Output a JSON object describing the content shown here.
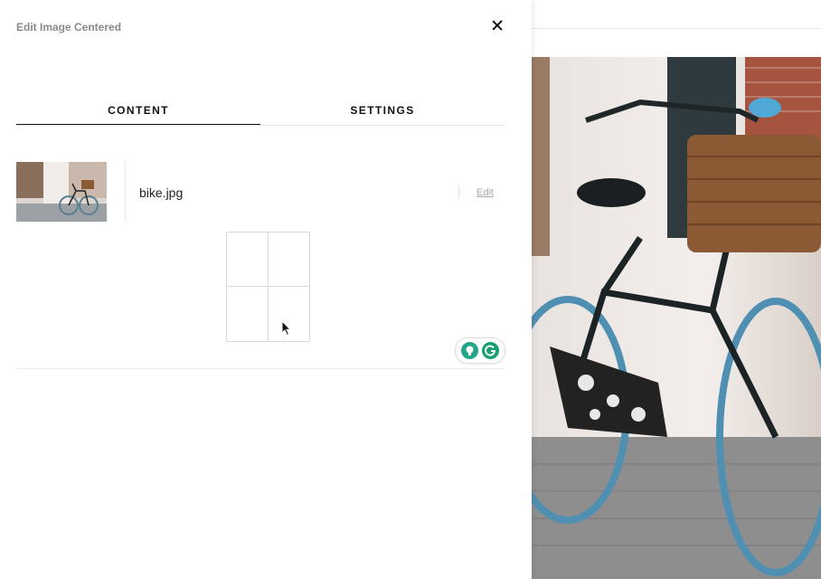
{
  "panel": {
    "title": "Edit Image Centered",
    "tabs": [
      {
        "label": "CONTENT",
        "active": true
      },
      {
        "label": "SETTINGS",
        "active": false
      }
    ]
  },
  "image": {
    "file_name": "bike.jpg",
    "edit_label": "Edit"
  },
  "colors": {
    "accent": "#111111",
    "grammarly_green": "#15a06f",
    "border": "#e6e6e6"
  },
  "icons": [
    "close-icon",
    "cursor-icon",
    "grammarly-suggestion-icon",
    "grammarly-logo-icon"
  ]
}
